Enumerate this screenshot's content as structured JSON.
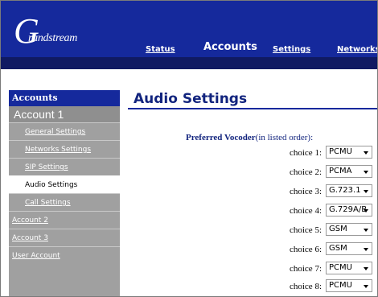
{
  "header": {
    "logo_initial": "G",
    "logo_text": "randstream",
    "nav": [
      {
        "label": "Status"
      },
      {
        "label": "Accounts"
      },
      {
        "label": "Settings"
      },
      {
        "label": "Networks"
      }
    ],
    "active_nav": "Accounts"
  },
  "sidebar": {
    "title": "Accounts",
    "account_label": "Account 1",
    "items": [
      {
        "label": "General Settings"
      },
      {
        "label": "Networks Settings"
      },
      {
        "label": "SIP Settings"
      },
      {
        "label": "Audio Settings"
      },
      {
        "label": "Call Settings"
      },
      {
        "label": "Account 2"
      },
      {
        "label": "Account 3"
      },
      {
        "label": "User Account"
      }
    ],
    "selected_item": "Audio Settings"
  },
  "main": {
    "title": "Audio Settings",
    "vocoder_label_bold": "Preferred Vocoder",
    "vocoder_label_rest": "(in listed order):",
    "choices": [
      {
        "label": "choice 1:",
        "value": "PCMU"
      },
      {
        "label": "choice 2:",
        "value": "PCMA"
      },
      {
        "label": "choice 3:",
        "value": "G.723.1"
      },
      {
        "label": "choice 4:",
        "value": "G.729A/B"
      },
      {
        "label": "choice 5:",
        "value": "GSM"
      },
      {
        "label": "choice 6:",
        "value": "GSM"
      },
      {
        "label": "choice 7:",
        "value": "PCMU"
      },
      {
        "label": "choice 8:",
        "value": "PCMU"
      }
    ]
  },
  "colors": {
    "header_blue": "#15299c",
    "header_band": "#101a62",
    "sidebar_gray": "#a0a0a0",
    "title_blue": "#12247e"
  },
  "icons": [
    "dropdown-arrow-icon"
  ]
}
